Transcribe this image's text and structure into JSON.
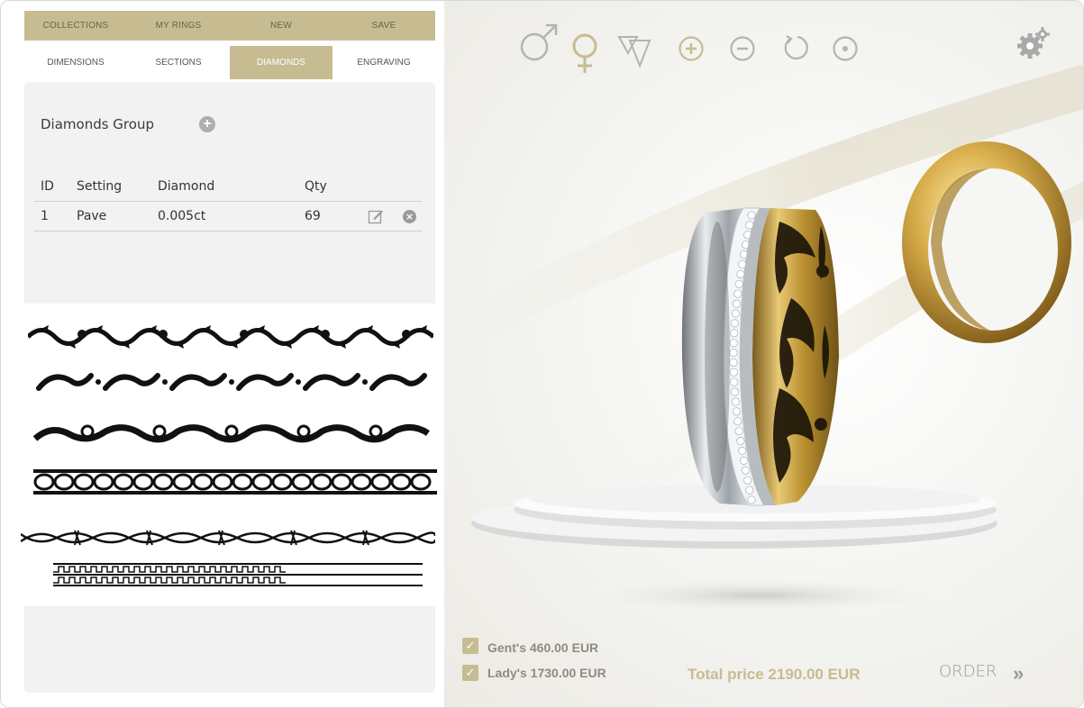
{
  "menu": {
    "top": [
      "COLLECTIONS",
      "MY RINGS",
      "NEW",
      "SAVE"
    ],
    "sub": [
      "DIMENSIONS",
      "SECTIONS",
      "DIAMONDS",
      "ENGRAVING"
    ],
    "active_sub": "DIAMONDS"
  },
  "diamonds": {
    "group_title": "Diamonds Group",
    "add_icon": "plus-circle-icon",
    "columns": [
      "ID",
      "Setting",
      "Diamond",
      "Qty"
    ],
    "rows": [
      {
        "id": "1",
        "setting": "Pave",
        "diamond": "0.005ct",
        "qty": "69"
      }
    ]
  },
  "toolbar": {
    "icons": [
      "male-icon",
      "female-icon",
      "rotate-view-icon",
      "zoom-in-icon",
      "zoom-out-icon",
      "reset-icon",
      "center-icon"
    ],
    "settings_icon": "gear-icon"
  },
  "pricing": {
    "gent_label": "Gent's 460.00 EUR",
    "lady_label": "Lady's 1730.00 EUR",
    "total_label": "Total price 2190.00 EUR",
    "order_label": "ORDER"
  },
  "colors": {
    "accent": "#c7bc91",
    "gold": "#c9a646",
    "silver": "#cfd3d6"
  }
}
